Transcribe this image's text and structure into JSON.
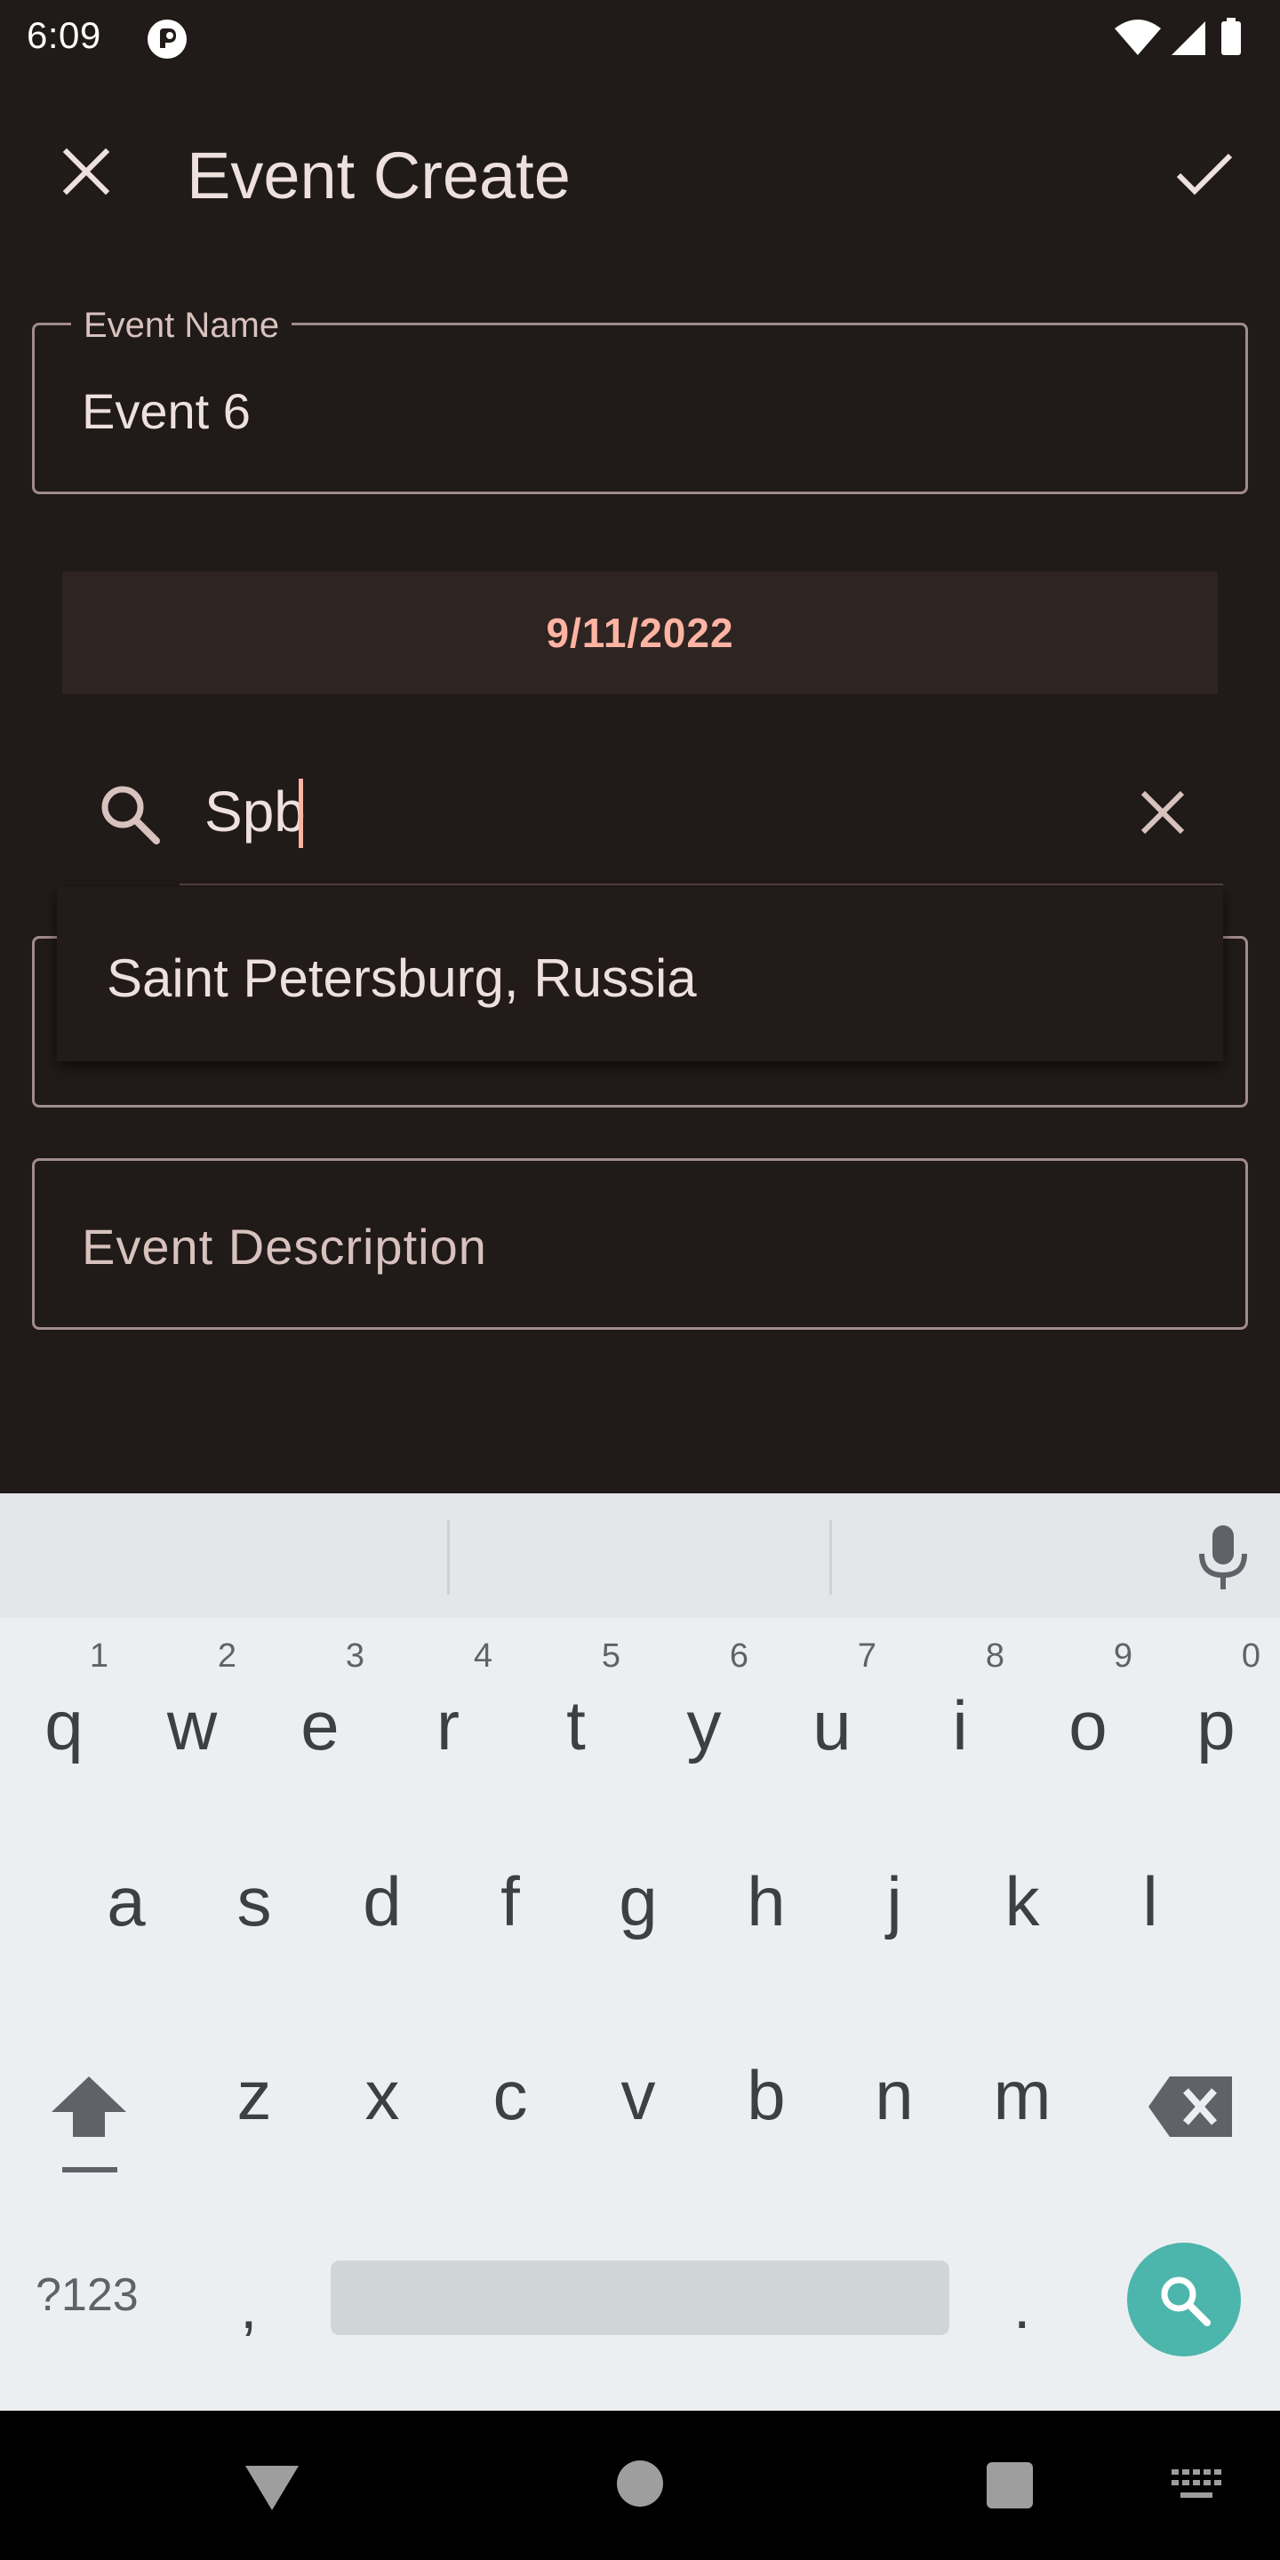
{
  "status_bar": {
    "time": "6:09"
  },
  "app_bar": {
    "title": "Event Create"
  },
  "event_name": {
    "label": "Event Name",
    "value": "Event 6"
  },
  "date_button": {
    "label": "9/11/2022"
  },
  "location_search": {
    "query": "Spb",
    "suggestions": [
      "Saint Petersburg, Russia"
    ]
  },
  "event_description": {
    "placeholder": "Event Description"
  },
  "keyboard": {
    "row1": [
      {
        "ch": "q",
        "num": "1"
      },
      {
        "ch": "w",
        "num": "2"
      },
      {
        "ch": "e",
        "num": "3"
      },
      {
        "ch": "r",
        "num": "4"
      },
      {
        "ch": "t",
        "num": "5"
      },
      {
        "ch": "y",
        "num": "6"
      },
      {
        "ch": "u",
        "num": "7"
      },
      {
        "ch": "i",
        "num": "8"
      },
      {
        "ch": "o",
        "num": "9"
      },
      {
        "ch": "p",
        "num": "0"
      }
    ],
    "row2": [
      "a",
      "s",
      "d",
      "f",
      "g",
      "h",
      "j",
      "k",
      "l"
    ],
    "row3": [
      "z",
      "x",
      "c",
      "v",
      "b",
      "n",
      "m"
    ],
    "symbols_label": "?123",
    "comma": ",",
    "period": "."
  },
  "colors": {
    "background": "#201a19",
    "accent": "#ffb4a3",
    "outline": "#a08c89",
    "keyboard_bg": "#eceff1",
    "search_action": "#4db6ac"
  },
  "icons": {
    "close": "close-icon",
    "confirm": "check-icon",
    "search": "search-icon",
    "clear": "clear-icon",
    "mic": "mic-icon",
    "shift": "shift-icon",
    "backspace": "backspace-icon"
  }
}
